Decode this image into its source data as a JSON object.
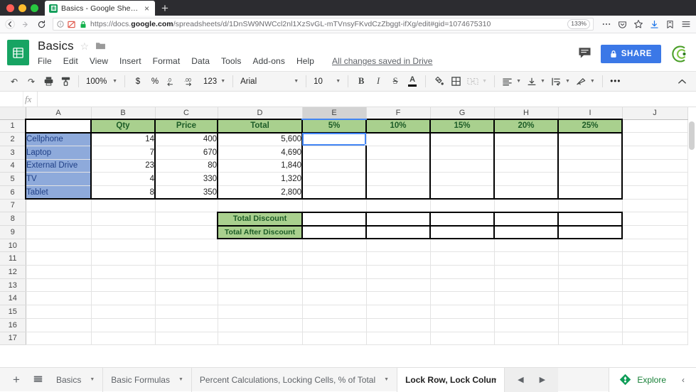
{
  "browser": {
    "tab": {
      "title": "Basics - Google Sheets",
      "favicon": "sheets-icon",
      "close": "×",
      "new_tab": "+"
    },
    "nav": {
      "back": "←",
      "forward": "→",
      "reload": "↻"
    },
    "url": {
      "prefix": "https://docs.",
      "host_bold": "google.com",
      "suffix": "/spreadsheets/d/1DnSW9NWCcl2nl1XzSvGL-mTVnsyFKvdCzZbggt-ifXg/edit#gid=1074675310",
      "zoom_level": "133%",
      "info_icon": "info-icon",
      "mixed_content_icon": "mixed-content-icon",
      "lock_icon": "padlock-icon"
    },
    "toolbar_icons": [
      "page-actions-icon",
      "pocket-icon",
      "bookmark-star-icon",
      "downloads-icon",
      "library-icon",
      "hamburger-menu-icon"
    ]
  },
  "sheets": {
    "doc_title": "Basics",
    "star_label": "☆",
    "menus": [
      "File",
      "Edit",
      "View",
      "Insert",
      "Format",
      "Data",
      "Tools",
      "Add-ons",
      "Help"
    ],
    "save_status": "All changes saved in Drive",
    "comment_icon": "comment-icon",
    "share_label": "SHARE",
    "share_color": "#3b78e7",
    "avatar": "account-avatar"
  },
  "toolbar": {
    "undo": "↶",
    "redo": "↷",
    "print": "print-icon",
    "paint": "paint-format-icon",
    "zoom": "100%",
    "currency": "$",
    "percent": "%",
    "dec_decrease": ".0",
    "dec_increase": ".00",
    "number_format": "123",
    "font": "Arial",
    "font_size": "10",
    "bold": "B",
    "italic": "I",
    "strikethrough": "S",
    "text_color": "A",
    "fill_color": "fill-color-icon",
    "borders": "borders-icon",
    "merge": "merge-cells-icon",
    "h_align": "horizontal-align-icon",
    "v_align": "vertical-align-icon",
    "text_wrap": "text-wrap-icon",
    "text_rotation": "text-rotation-icon",
    "more": "•••",
    "collapse": "⌃"
  },
  "formula_bar": {
    "name_box": "",
    "fx": "fx",
    "value": ""
  },
  "grid": {
    "columns": [
      "A",
      "B",
      "C",
      "D",
      "E",
      "F",
      "G",
      "H",
      "I",
      "J"
    ],
    "selected_column": "E",
    "selected_cell": "E2",
    "rows": [
      "1",
      "2",
      "3",
      "4",
      "5",
      "6",
      "7",
      "8",
      "9",
      "10",
      "11",
      "12",
      "13",
      "14",
      "15",
      "16",
      "17"
    ],
    "colors": {
      "header_green": "#a9d08e",
      "header_green_text": "#1d5c27",
      "label_blue": "#8eaadb",
      "label_blue_text": "#1f3f86",
      "selection": "#4285f4"
    },
    "data": {
      "headers": {
        "B": "Qty",
        "C": "Price",
        "D": "Total",
        "E": "5%",
        "F": "10%",
        "G": "15%",
        "H": "20%",
        "I": "25%"
      },
      "items": [
        {
          "row": "2",
          "name": "Cellphone",
          "qty": "14",
          "price": "400",
          "total": "5,600"
        },
        {
          "row": "3",
          "name": "Laptop",
          "qty": "7",
          "price": "670",
          "total": "4,690"
        },
        {
          "row": "4",
          "name": "External Drive",
          "qty": "23",
          "price": "80",
          "total": "1,840"
        },
        {
          "row": "5",
          "name": "TV",
          "qty": "4",
          "price": "330",
          "total": "1,320"
        },
        {
          "row": "6",
          "name": "Tablet",
          "qty": "8",
          "price": "350",
          "total": "2,800"
        }
      ],
      "summary": [
        {
          "row": "8",
          "label": "Total Discount"
        },
        {
          "row": "9",
          "label": "Total After Discount"
        }
      ]
    }
  },
  "sheet_tabs": {
    "add_sheet": "+",
    "all_sheets": "all-sheets-icon",
    "tabs": [
      {
        "label": "Basics",
        "active": false
      },
      {
        "label": "Basic Formulas",
        "active": false
      },
      {
        "label": "Percent Calculations, Locking Cells, % of Total",
        "active": false
      },
      {
        "label": "Lock Row, Lock Column",
        "active": true
      }
    ],
    "prev_arrow": "◀",
    "next_arrow": "▶",
    "explore_label": "Explore",
    "explore_icon": "explore-diamond-icon",
    "collapse": "‹"
  }
}
